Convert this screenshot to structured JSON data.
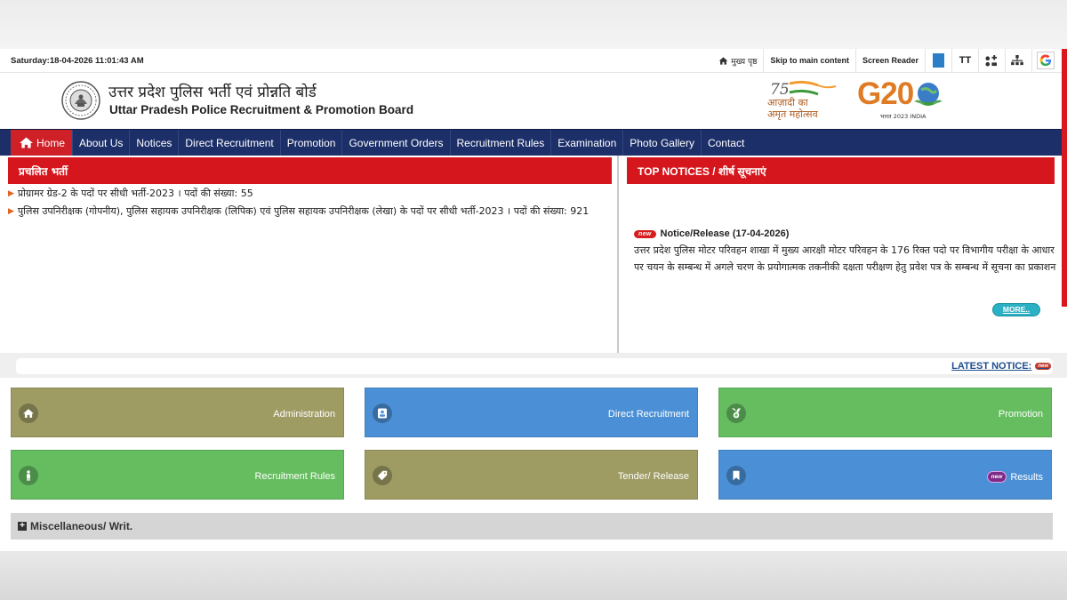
{
  "topbar": {
    "datetime": "Saturday:18-04-2026 11:01:43 AM",
    "home_link": "मुख्य पृष्ठ",
    "skip_link": "Skip to main content",
    "screen_reader": "Screen Reader",
    "font_size_glyph": "TT"
  },
  "header": {
    "title_hindi": "उत्तर प्रदेश पुलिस भर्ती एवं प्रोन्नति बोर्ड",
    "title_english": "Uttar Pradesh Police Recruitment & Promotion Board",
    "azadi_line1": "आज़ादी का",
    "azadi_line2": "अमृत महोत्सव",
    "g20_text": "G20",
    "g20_sub": "भारत 2023 INDIA"
  },
  "nav": {
    "items": [
      "Home",
      "About Us",
      "Notices",
      "Direct Recruitment",
      "Promotion",
      "Government Orders",
      "Recruitment Rules",
      "Examination",
      "Photo Gallery",
      "Contact"
    ]
  },
  "recruitment": {
    "heading": "प्रचलित भर्ती",
    "items": [
      "प्रोग्रामर ग्रेड-2 के पदों पर सीधी भर्ती-2023 । पदों की संख्या: 55",
      "पुलिस उपनिरीक्षक (गोपनीय), पुलिस सहायक उपनिरीक्षक (लिपिक) एवं पुलिस सहायक उपनिरीक्षक (लेखा) के पदों पर सीधी भर्ती-2023 । पदों की संख्या: 921"
    ]
  },
  "notices": {
    "heading": "TOP NOTICES / शीर्ष सूचनाएं",
    "new_badge": "new",
    "item_title": "Notice/Release (17-04-2026)",
    "item_body": "उत्तर प्रदेश पुलिस मोटर परिवहन शाखा में मुख्य आरक्षी मोटर परिवहन के 176 रिक्त पदो पर विभागीय परीक्षा के आधार पर चयन के सम्बन्ध में अगले चरण के प्रयोगात्मक तकनीकी दक्षता परीक्षण हेतु प्रवेश पत्र के सम्बन्ध में सूचना का प्रकाशन",
    "more_label": "MORE.."
  },
  "latest": {
    "label": "LATEST NOTICE:",
    "badge": "new"
  },
  "tiles": [
    {
      "label": "Administration",
      "icon": "home-icon"
    },
    {
      "label": "Direct Recruitment",
      "icon": "id-card-icon"
    },
    {
      "label": "Promotion",
      "icon": "medal-icon"
    },
    {
      "label": "Recruitment Rules",
      "icon": "person-icon"
    },
    {
      "label": "Tender/ Release",
      "icon": "tag-icon"
    },
    {
      "label": "Results",
      "icon": "bookmark-icon",
      "badge": "new"
    }
  ],
  "misc": {
    "label": "Miscellaneous/ Writ."
  },
  "colors": {
    "nav_bg": "#1c2f68",
    "red": "#d6161d",
    "olive": "#9e9b63",
    "blue": "#4b90d6",
    "green": "#65bd60"
  }
}
